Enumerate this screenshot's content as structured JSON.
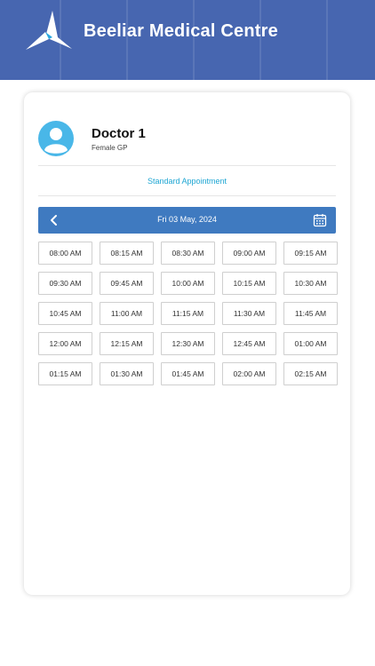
{
  "header": {
    "title": "Beeliar Medical Centre",
    "logo_icon": "triangle-logo-icon"
  },
  "doctor": {
    "name": "Doctor 1",
    "role": "Female GP",
    "avatar_icon": "user-avatar-icon"
  },
  "appointment": {
    "type": "Standard Appointment"
  },
  "date_nav": {
    "date": "Fri 03 May, 2024",
    "prev_icon": "chevron-left-icon",
    "calendar_icon": "calendar-icon"
  },
  "slots": [
    "08:00 AM",
    "08:15 AM",
    "08:30 AM",
    "09:00 AM",
    "09:15 AM",
    "09:30 AM",
    "09:45 AM",
    "10:00 AM",
    "10:15 AM",
    "10:30 AM",
    "10:45 AM",
    "11:00 AM",
    "11:15 AM",
    "11:30 AM",
    "11:45 AM",
    "12:00 AM",
    "12:15 AM",
    "12:30 AM",
    "12:45 AM",
    "01:00 AM",
    "01:15 AM",
    "01:30 AM",
    "01:45 AM",
    "02:00 AM",
    "02:15 AM"
  ],
  "colors": {
    "header_bg": "#4766b0",
    "datebar_bg": "#3f7ac0",
    "accent": "#1fa6d3",
    "avatar": "#49b7e8"
  }
}
